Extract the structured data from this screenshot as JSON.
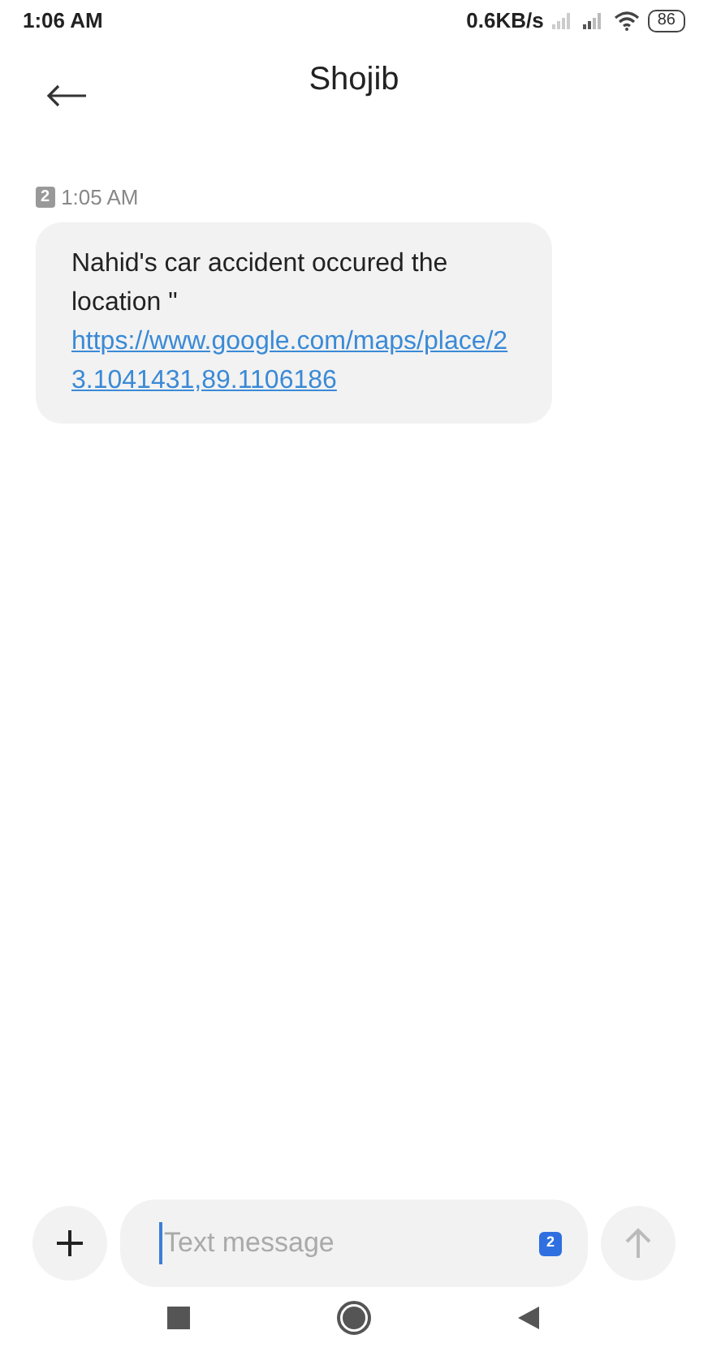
{
  "status_bar": {
    "time": "1:06 AM",
    "speed": "0.6KB/s",
    "battery": "86"
  },
  "header": {
    "title": "Shojib"
  },
  "messages": [
    {
      "sim": "2",
      "time": "1:05 AM",
      "text": "Nahid's car accident occured the location \" ",
      "link": "https://www.google.com/maps/place/23.1041431,89.1106186"
    }
  ],
  "composer": {
    "placeholder": "Text message",
    "sim": "2"
  }
}
